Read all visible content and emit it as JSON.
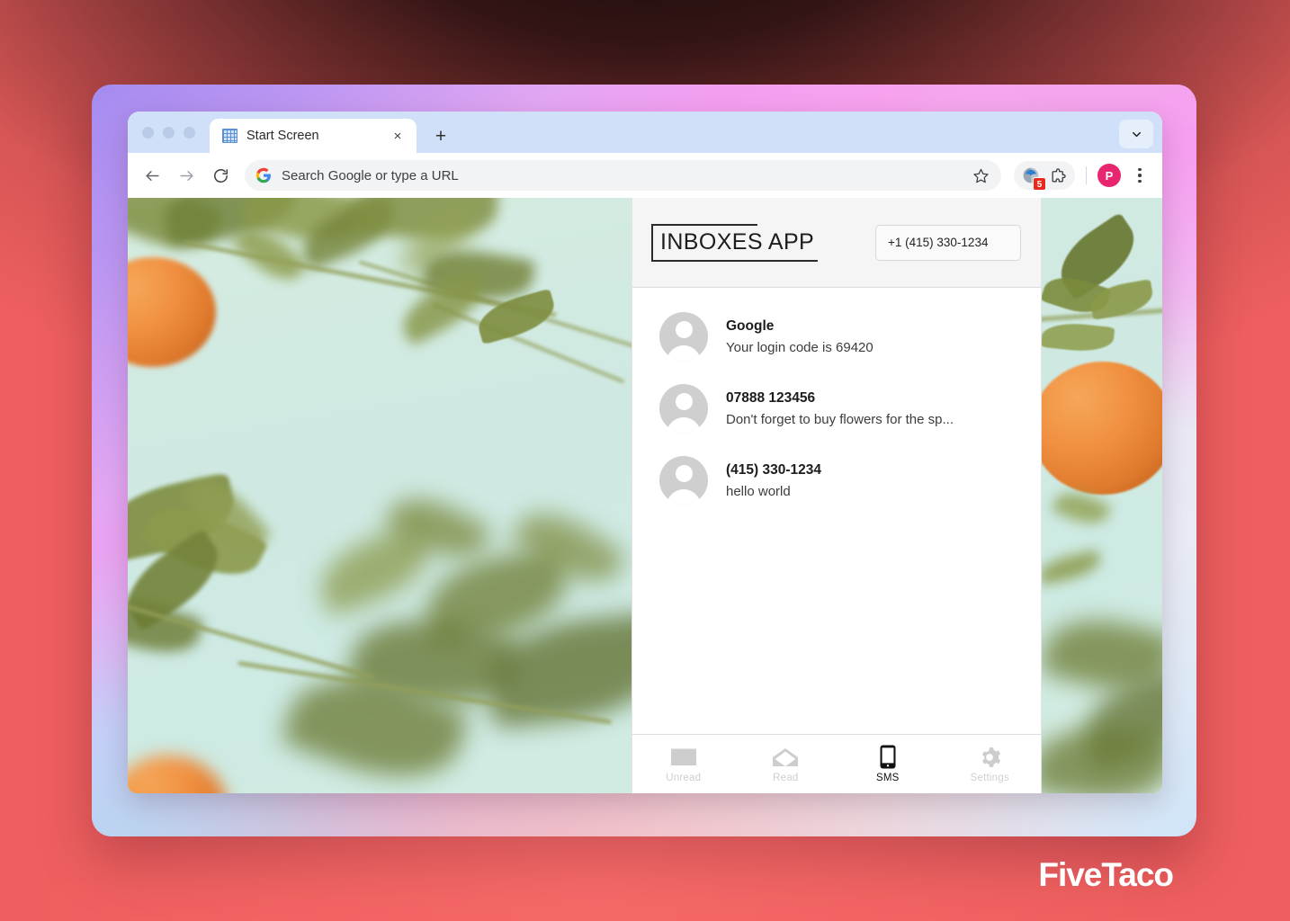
{
  "browser": {
    "window_dots": [
      "close",
      "minimize",
      "maximize"
    ],
    "tab": {
      "title": "Start Screen",
      "favicon": "grid-icon",
      "close_label": "×"
    },
    "new_tab_label": "+",
    "tabstrip_expand_icon": "chevron-down-icon",
    "toolbar": {
      "back_icon": "arrow-left-icon",
      "forward_icon": "arrow-right-icon",
      "reload_icon": "reload-icon",
      "omnibox_placeholder": "Search Google or type a URL",
      "omnibox_value": "",
      "omnibox_leading_icon": "google-g-icon",
      "bookmark_icon": "star-icon",
      "extension_badge_count": "5",
      "extension_puzzle_icon": "puzzle-icon",
      "profile_initial": "P",
      "menu_icon": "kebab-menu-icon"
    }
  },
  "app": {
    "brand": "INBOXES APP",
    "phone_number": "+1 (415) 330-1234",
    "messages": [
      {
        "sender": "Google",
        "preview": "Your login code is 69420"
      },
      {
        "sender": "07888 123456",
        "preview": "Don't forget to buy flowers for the sp..."
      },
      {
        "sender": "(415) 330-1234",
        "preview": "hello world"
      }
    ],
    "nav": [
      {
        "label": "Unread",
        "icon": "envelope-closed-icon",
        "active": false
      },
      {
        "label": "Read",
        "icon": "envelope-open-icon",
        "active": false
      },
      {
        "label": "SMS",
        "icon": "phone-icon",
        "active": true
      },
      {
        "label": "Settings",
        "icon": "gear-icon",
        "active": false
      }
    ]
  },
  "watermark": "FiveTaco",
  "colors": {
    "accent_pink": "#e8266f",
    "badge_red": "#e8291b",
    "desktop_red": "#ef5f5f",
    "panel_bg": "#ffffff",
    "header_bg": "#f5f5f5"
  }
}
